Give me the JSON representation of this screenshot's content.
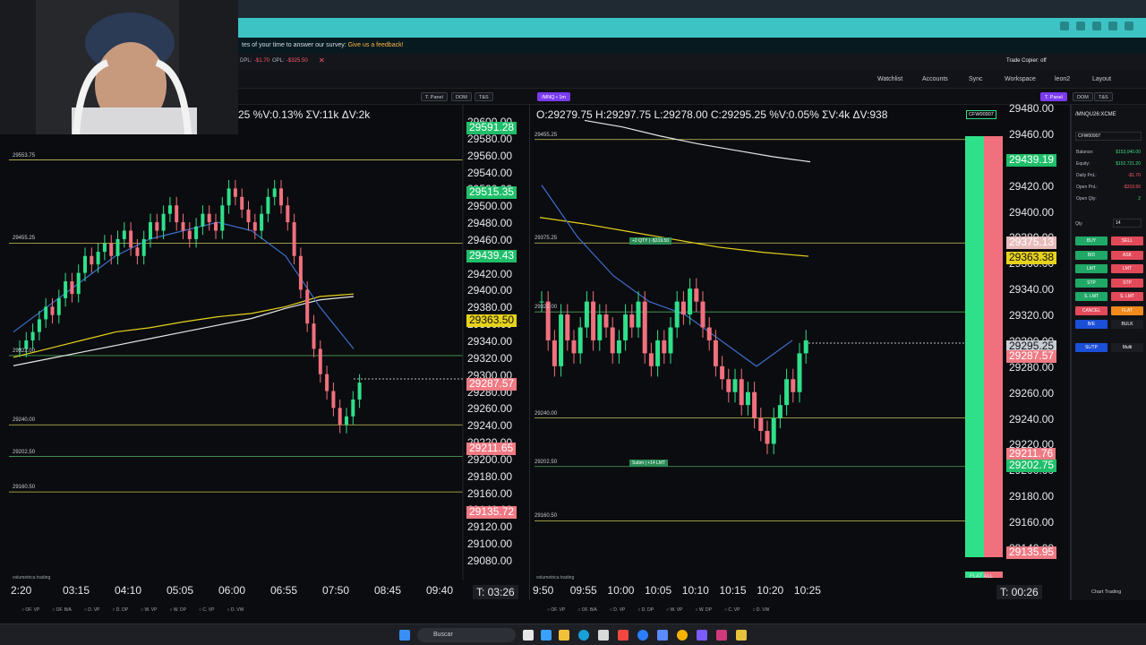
{
  "survey": {
    "text": "tes of your time to answer our survey:",
    "link": "Give us a feedback!"
  },
  "toolbar1": {
    "dpl": "DPL:",
    "dpl_val": "-$1.70",
    "opl": "OPL:",
    "opl_val": "-$325.50",
    "trade_copier": "Trade Copier: off"
  },
  "toolbar2": {
    "items": [
      "Watchlist",
      "Accounts",
      "Sync",
      "Workspace",
      "leon2",
      "Layout"
    ]
  },
  "left_chart": {
    "header_buttons": [
      "T. Panel",
      "DOM",
      "T&S"
    ],
    "ohlc": "25 %V:0.13% ΣV:11k ΔV:2k",
    "y_ticks": [
      "29600.00",
      "29580.00",
      "29560.00",
      "29540.00",
      "29520.00",
      "29500.00",
      "29480.00",
      "29460.00",
      "29440.00",
      "29420.00",
      "29400.00",
      "29380.00",
      "29360.00",
      "29340.00",
      "29320.00",
      "29300.00",
      "29280.00",
      "29260.00",
      "29240.00",
      "29220.00",
      "29200.00",
      "29180.00",
      "29160.00",
      "29140.00",
      "29120.00",
      "29100.00",
      "29080.00"
    ],
    "price_boxes": [
      {
        "v": "29591.28",
        "c": "#1fbf6a"
      },
      {
        "v": "29515.35",
        "c": "#1fbf6a"
      },
      {
        "v": "29439.43",
        "c": "#1fbf6a"
      },
      {
        "v": "29363.50",
        "c": "#e7d21c"
      },
      {
        "v": "29287.57",
        "c": "#f07a84"
      },
      {
        "v": "29211.65",
        "c": "#f07a84"
      },
      {
        "v": "29135.72",
        "c": "#f07a84"
      }
    ],
    "levels": [
      "29553.75",
      "29455.25",
      "29322.00",
      "29240.00",
      "29202.50",
      "29160.50"
    ],
    "x_ticks": [
      "2:20",
      "03:15",
      "04:10",
      "05:05",
      "06:00",
      "06:55",
      "07:50",
      "08:45",
      "09:40"
    ],
    "timer": "T: 03:26",
    "footer": [
      "OF. VP",
      "OF. B/A",
      "D. VP",
      "D. DP",
      "W. VP",
      "W. DP",
      "C. VP",
      "D. VW"
    ],
    "watermark": "volumetrica trading"
  },
  "right_chart": {
    "symbol_tab": "/MNQ • 1m",
    "header_buttons": [
      "T. Panel",
      "DOM",
      "T&S"
    ],
    "ohlc": "O:29279.75 H:29297.75 L:29278.00 C:29295.25 %V:0.05% ΣV:4k ΔV:938",
    "y_ticks": [
      "29480.00",
      "29460.00",
      "29440.00",
      "29420.00",
      "29400.00",
      "29380.00",
      "29360.00",
      "29340.00",
      "29320.00",
      "29300.00",
      "29280.00",
      "29260.00",
      "29240.00",
      "29220.00",
      "29200.00",
      "29180.00",
      "29160.00",
      "29140.00"
    ],
    "price_boxes": [
      {
        "v": "29439.19",
        "c": "#1fbf6a"
      },
      {
        "v": "29375.13",
        "c": "#e9bcbc"
      },
      {
        "v": "29363.38",
        "c": "#e7d21c"
      },
      {
        "v": "29295.25",
        "c": "#c8ccd4"
      },
      {
        "v": "29287.57",
        "c": "#f07a84"
      },
      {
        "v": "29211.76",
        "c": "#f07a84"
      },
      {
        "v": "29202.75",
        "c": "#1fbf6a"
      },
      {
        "v": "29135.95",
        "c": "#f07a84"
      }
    ],
    "levels": [
      "29455.25",
      "29375.25",
      "29322.00",
      "29240.00",
      "29202.50",
      "29160.50"
    ],
    "x_ticks": [
      "9:50",
      "09:55",
      "10:00",
      "10:05",
      "10:10",
      "10:15",
      "10:20",
      "10:25"
    ],
    "timer": "T: 00:26",
    "account_tag": "CFW00907",
    "position_tag": "+2 QTY | -$319.50",
    "order_tag": "Subm | +14 LMT",
    "flat_all": "FLAT ALL",
    "footer": [
      "OF. VP",
      "OF. B/A",
      "D. VP",
      "D. DP",
      "W. VP",
      "W. DP",
      "C. VP",
      "D. VW"
    ],
    "watermark": "volumetrica trading"
  },
  "order_panel": {
    "symbol": "/MNQU26:XCME",
    "account": "CFW00907",
    "rows": [
      {
        "k": "Balance:",
        "v": "$153,040.00",
        "c": "#3ddc84"
      },
      {
        "k": "Equity:",
        "v": "$152,721.20",
        "c": "#3ddc84"
      },
      {
        "k": "Daily PnL:",
        "v": "-$1.70",
        "c": "#ff5a6a"
      },
      {
        "k": "Open PnL:",
        "v": "-$319.50",
        "c": "#ff5a6a"
      },
      {
        "k": "Open Qty:",
        "v": "2",
        "c": "#3ddc84"
      }
    ],
    "qty_label": "Qty",
    "qty_value": "14",
    "buttons": [
      [
        "BUY",
        "SELL"
      ],
      [
        "BID",
        "ASK"
      ],
      [
        "LMT",
        "LMT"
      ],
      [
        "STP",
        "STP"
      ],
      [
        "S. LMT",
        "S. LMT"
      ],
      [
        "CANCEL",
        "FLAT"
      ],
      [
        "B/E",
        "BULK"
      ]
    ],
    "sltp": "SL/TP",
    "multi": "Multi",
    "chart_trading": "Chart Trading"
  },
  "taskbar": {
    "search_placeholder": "Buscar"
  }
}
